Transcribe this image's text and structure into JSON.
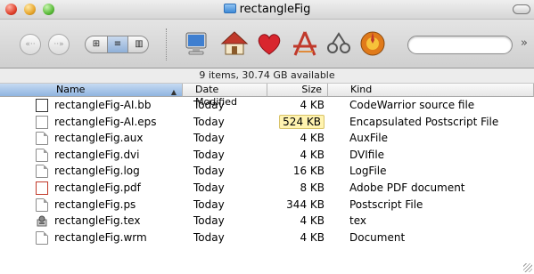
{
  "window": {
    "title": "rectangleFig"
  },
  "status": {
    "text": "9 items, 30.74 GB available"
  },
  "columns": {
    "name": "Name",
    "date": "Date Modified",
    "size": "Size",
    "kind": "Kind"
  },
  "toolbar": {
    "back_glyph": "«··",
    "forward_glyph": "··»",
    "view_icon": "⊞",
    "view_list": "≡",
    "view_columns": "▥",
    "overflow": "»",
    "icons": [
      "computer-icon",
      "home-icon",
      "favorites-icon",
      "applications-icon",
      "utilities-icon",
      "orange-app-icon"
    ]
  },
  "files": [
    {
      "name": "rectangleFig-AI.bb",
      "date": "Today",
      "size": "4 KB",
      "kind": "CodeWarrior source file",
      "icon": "codewarrior-file-icon"
    },
    {
      "name": "rectangleFig-AI.eps",
      "date": "Today",
      "size": "524 KB",
      "kind": "Encapsulated Postscript File",
      "icon": "eps-file-icon"
    },
    {
      "name": "rectangleFig.aux",
      "date": "Today",
      "size": "4 KB",
      "kind": "AuxFile",
      "icon": "document-icon"
    },
    {
      "name": "rectangleFig.dvi",
      "date": "Today",
      "size": "4 KB",
      "kind": "DVIfile",
      "icon": "document-icon"
    },
    {
      "name": "rectangleFig.log",
      "date": "Today",
      "size": "16 KB",
      "kind": "LogFile",
      "icon": "document-icon"
    },
    {
      "name": "rectangleFig.pdf",
      "date": "Today",
      "size": "8 KB",
      "kind": "Adobe PDF document",
      "icon": "pdf-file-icon"
    },
    {
      "name": "rectangleFig.ps",
      "date": "Today",
      "size": "344 KB",
      "kind": "Postscript File",
      "icon": "document-icon"
    },
    {
      "name": "rectangleFig.tex",
      "date": "Today",
      "size": "4 KB",
      "kind": "tex",
      "icon": "tex-file-icon"
    },
    {
      "name": "rectangleFig.wrm",
      "date": "Today",
      "size": "4 KB",
      "kind": "Document",
      "icon": "document-icon"
    }
  ]
}
